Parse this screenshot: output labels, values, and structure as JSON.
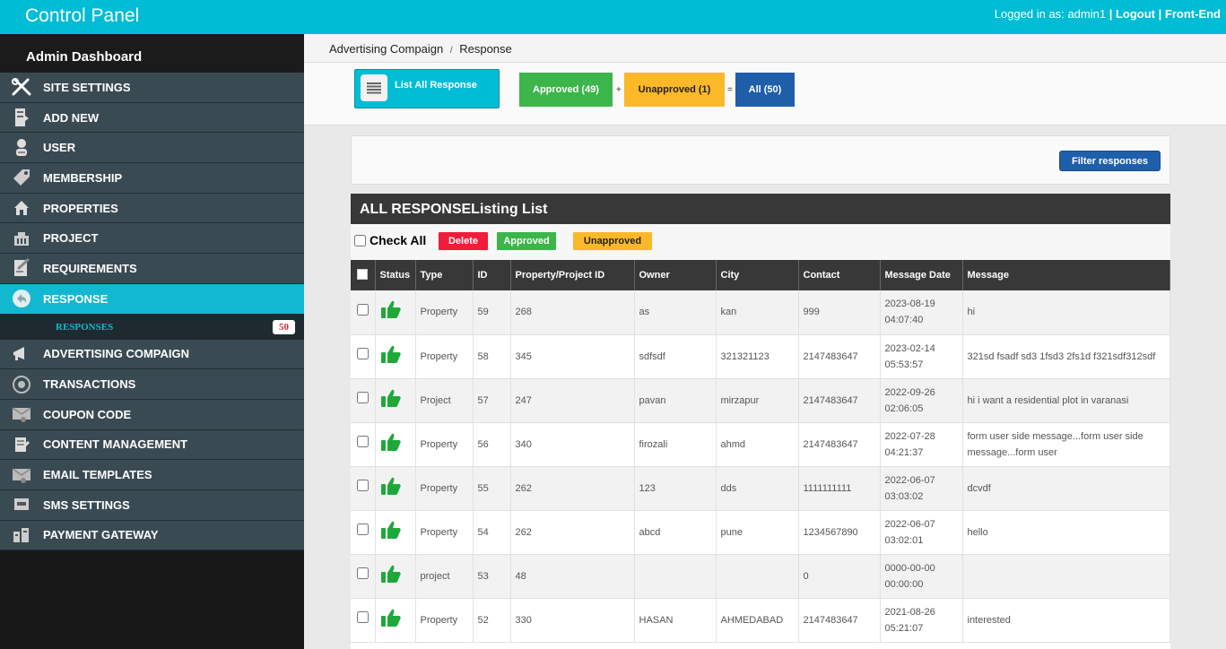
{
  "topbar": {
    "title": "Control Panel",
    "logged_in_label": "Logged in as:",
    "username": "admin1",
    "sep1": "|",
    "logout": "Logout",
    "sep2": "|",
    "frontend": "Front-End"
  },
  "sidebar": {
    "dashboard": "Admin Dashboard",
    "items": [
      {
        "label": "SITE SETTINGS",
        "icon": "tools-icon"
      },
      {
        "label": "ADD NEW",
        "icon": "add-page-icon"
      },
      {
        "label": "USER",
        "icon": "user-icon"
      },
      {
        "label": "MEMBERSHIP",
        "icon": "tag-icon"
      },
      {
        "label": "PROPERTIES",
        "icon": "house-icon"
      },
      {
        "label": "PROJECT",
        "icon": "building-icon"
      },
      {
        "label": "REQUIREMENTS",
        "icon": "checklist-icon"
      },
      {
        "label": "RESPONSE",
        "icon": "reply-icon"
      },
      {
        "label": "ADVERTISING COMPAIGN",
        "icon": "megaphone-icon"
      },
      {
        "label": "TRANSACTIONS",
        "icon": "transactions-icon"
      },
      {
        "label": "COUPON CODE",
        "icon": "coupon-icon"
      },
      {
        "label": "CONTENT MANAGEMENT",
        "icon": "content-icon"
      },
      {
        "label": "EMAIL TEMPLATES",
        "icon": "email-icon"
      },
      {
        "label": "SMS SETTINGS",
        "icon": "sms-icon"
      },
      {
        "label": "PAYMENT GATEWAY",
        "icon": "payment-icon"
      }
    ],
    "submenu": {
      "label": "RESPONSES",
      "count": "50"
    }
  },
  "breadcrumb": {
    "first": "Advertising Compaign",
    "sep": "/",
    "second": "Response"
  },
  "actions": {
    "list_all": "List All Response",
    "approved": "Approved (49)",
    "plus": "+",
    "unapproved": "Unapproved (1)",
    "equals": "=",
    "all": "All (50)"
  },
  "filter": {
    "button": "Filter responses"
  },
  "panel": {
    "title": "ALL RESPONSEListing List",
    "check_all": "Check All",
    "delete": "Delete",
    "approved": "Approved",
    "unapproved": "Unapproved"
  },
  "table": {
    "headers": [
      "Status",
      "Type",
      "ID",
      "Property/Project ID",
      "Owner",
      "City",
      "Contact",
      "Message Date",
      "Message"
    ],
    "rows": [
      {
        "type": "Property",
        "id": "59",
        "pid": "268",
        "owner": "as",
        "city": "kan",
        "contact": "999",
        "date": "2023-08-19",
        "time": "04:07:40",
        "message": "hi"
      },
      {
        "type": "Property",
        "id": "58",
        "pid": "345",
        "owner": "sdfsdf",
        "city": "321321123",
        "contact": "2147483647",
        "date": "2023-02-14",
        "time": "05:53:57",
        "message": "321sd fsadf sd3 1fsd3 2fs1d f321sdf312sdf"
      },
      {
        "type": "Project",
        "id": "57",
        "pid": "247",
        "owner": "pavan",
        "city": "mirzapur",
        "contact": "2147483647",
        "date": "2022-09-26",
        "time": "02:06:05",
        "message": "hi i want a residential plot in varanasi"
      },
      {
        "type": "Property",
        "id": "56",
        "pid": "340",
        "owner": "firozali",
        "city": "ahmd",
        "contact": "2147483647",
        "date": "2022-07-28",
        "time": "04:21:37",
        "message": "form user side message...form user side message...form user"
      },
      {
        "type": "Property",
        "id": "55",
        "pid": "262",
        "owner": "123",
        "city": "dds",
        "contact": "1111111111",
        "date": "2022-06-07",
        "time": "03:03:02",
        "message": "dcvdf"
      },
      {
        "type": "Property",
        "id": "54",
        "pid": "262",
        "owner": "abcd",
        "city": "pune",
        "contact": "1234567890",
        "date": "2022-06-07",
        "time": "03:02:01",
        "message": "hello"
      },
      {
        "type": "project",
        "id": "53",
        "pid": "48",
        "owner": "",
        "city": "",
        "contact": "0",
        "date": "0000-00-00",
        "time": "00:00:00",
        "message": ""
      },
      {
        "type": "Property",
        "id": "52",
        "pid": "330",
        "owner": "HASAN",
        "city": "AHMEDABAD",
        "contact": "2147483647",
        "date": "2021-08-26",
        "time": "05:21:07",
        "message": "interested"
      }
    ]
  },
  "colors": {
    "accent": "#00bcd4",
    "approved": "#3cb54a",
    "unapproved": "#fbb829",
    "all": "#1f5fa9",
    "delete": "#ef1c3a",
    "thumb": "#1fa83a"
  }
}
